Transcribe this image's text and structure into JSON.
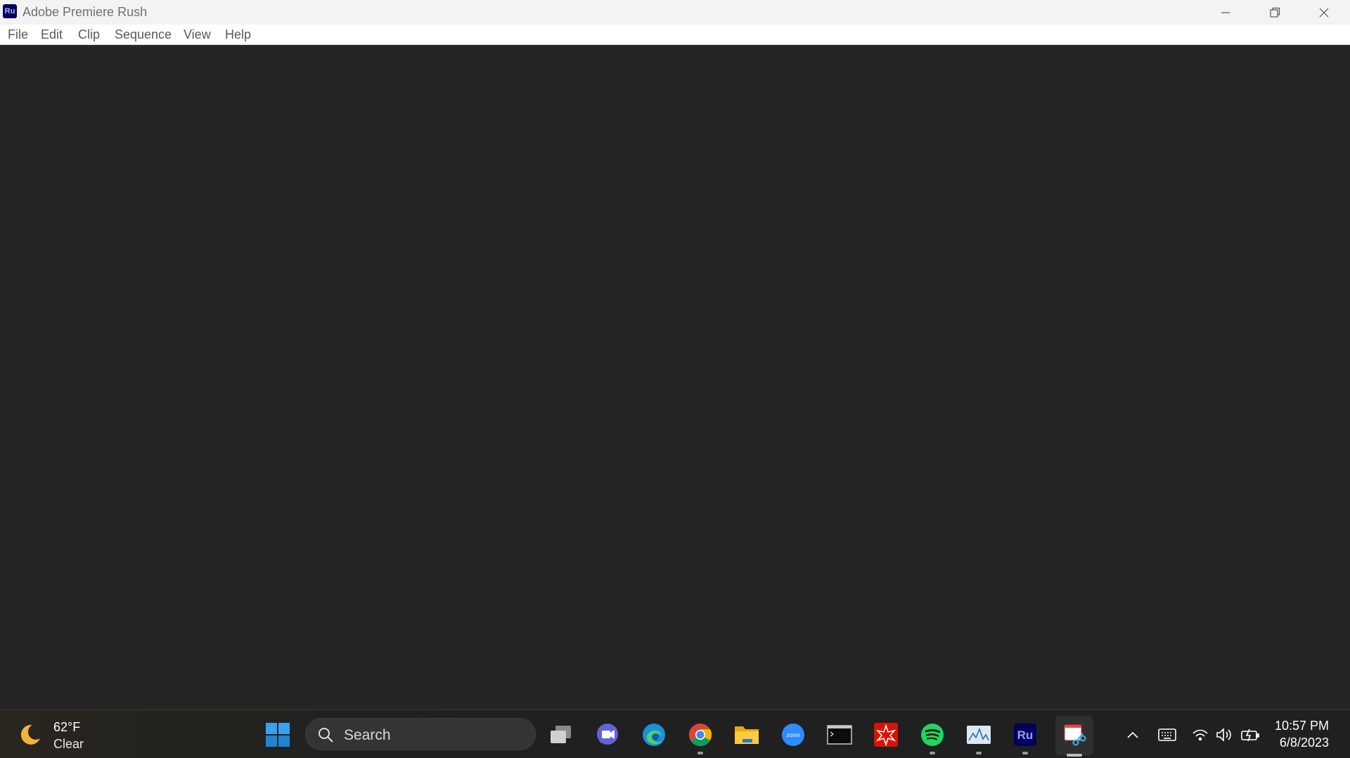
{
  "window": {
    "title": "Adobe Premiere Rush",
    "logo_text": "Ru"
  },
  "menu": {
    "items": [
      "File",
      "Edit",
      "Clip",
      "Sequence",
      "View",
      "Help"
    ]
  },
  "taskbar": {
    "weather": {
      "temp": "62°F",
      "condition": "Clear",
      "icon": "moon-icon"
    },
    "search_placeholder": "Search",
    "apps": [
      {
        "name": "start-icon"
      },
      {
        "name": "task-view-icon"
      },
      {
        "name": "teams-chat-icon"
      },
      {
        "name": "edge-icon"
      },
      {
        "name": "chrome-icon"
      },
      {
        "name": "file-explorer-icon"
      },
      {
        "name": "zoom-icon",
        "label": "zoom"
      },
      {
        "name": "terminal-icon"
      },
      {
        "name": "mathematica-icon"
      },
      {
        "name": "spotify-icon"
      },
      {
        "name": "resource-monitor-icon"
      },
      {
        "name": "premiere-rush-icon",
        "label": "Ru"
      },
      {
        "name": "snipping-tool-icon"
      }
    ],
    "tray": [
      "chevron-up-icon",
      "keyboard-icon",
      "wifi-icon",
      "volume-icon",
      "battery-icon"
    ],
    "clock": {
      "time": "10:57 PM",
      "date": "6/8/2023"
    }
  },
  "colors": {
    "workspace_bg": "#252525",
    "titlebar_bg": "#f3f3f3",
    "taskbar_bg": "#202020",
    "rush_brand": "#00005b"
  }
}
